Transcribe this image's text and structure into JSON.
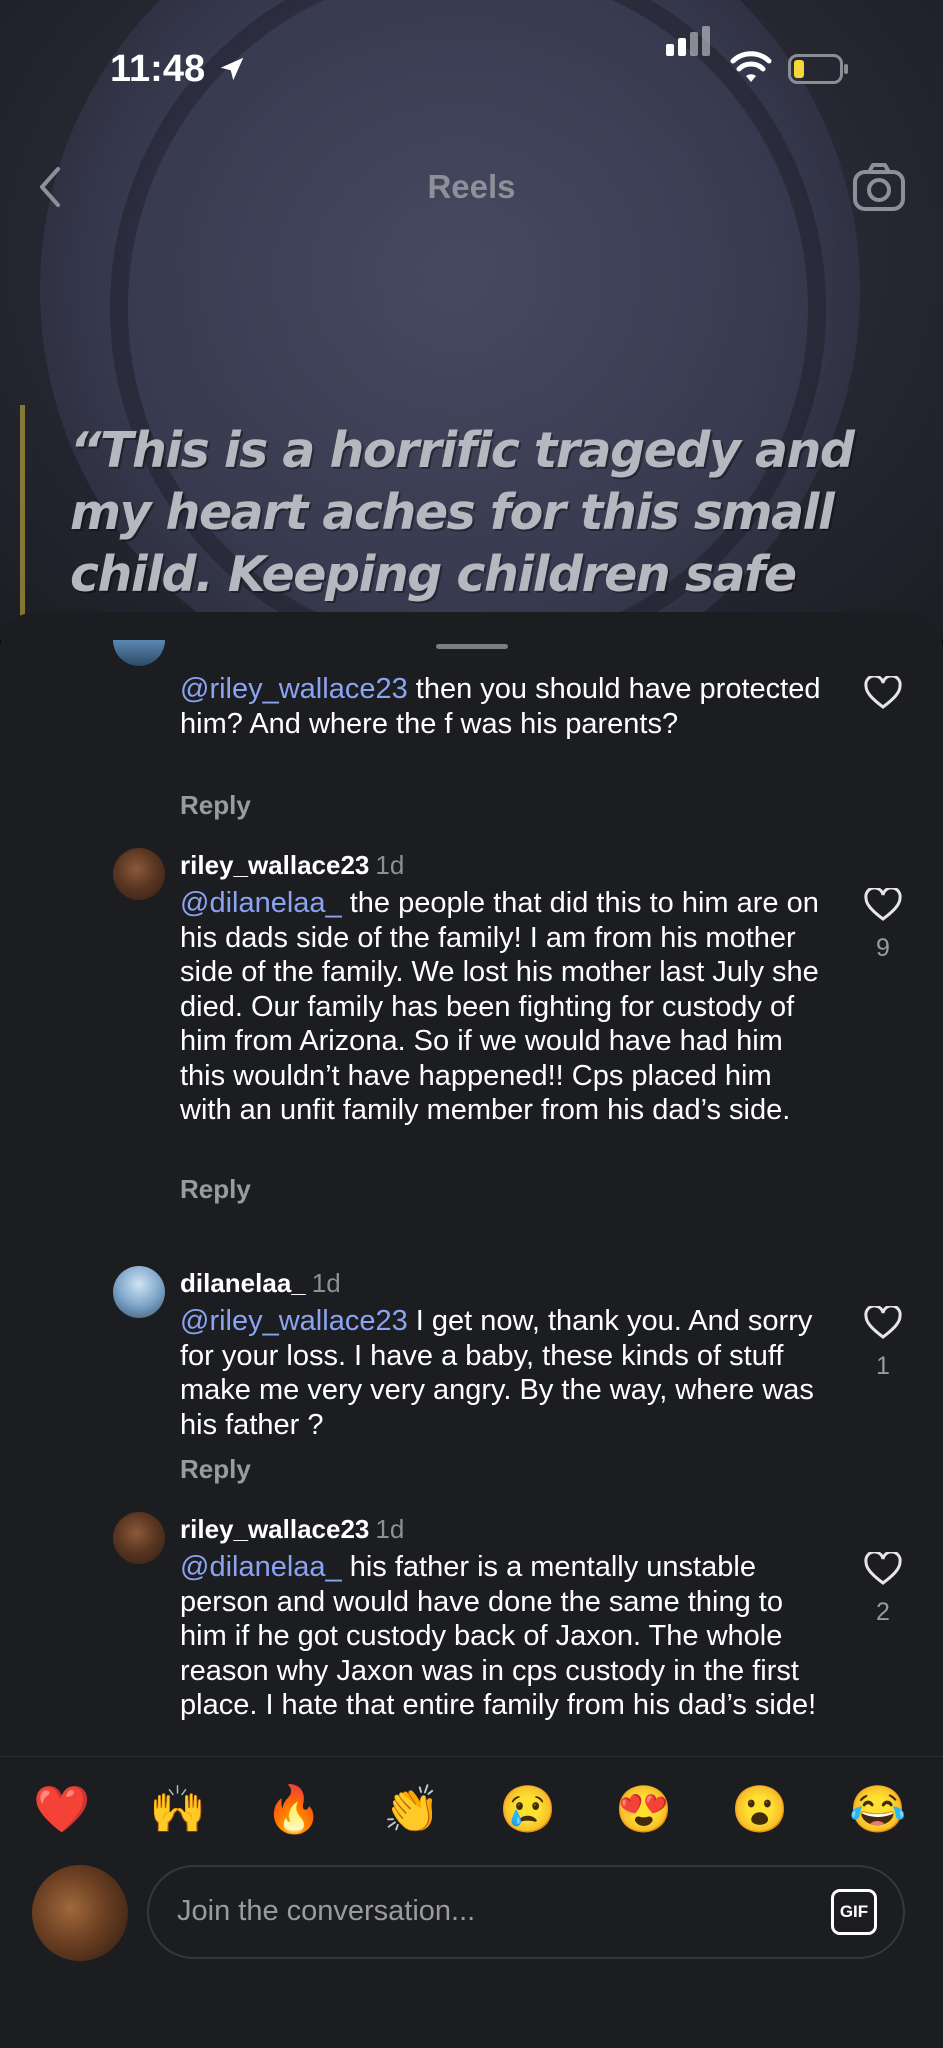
{
  "status_bar": {
    "time": "11:48",
    "battery_color": "#f4d83a"
  },
  "header": {
    "title": "Reels",
    "back_icon": "chevron-left-icon",
    "camera_icon": "camera-icon"
  },
  "reel": {
    "quote": "“This is a horrific tragedy and my heart aches for this small child. Keeping children safe"
  },
  "comments": [
    {
      "mention": "@riley_wallace23",
      "text": " then you should have protected him? And where the f was his parents?",
      "reply": "Reply"
    },
    {
      "user": "riley_wallace23",
      "age": "1d",
      "mention": "@dilanelaa_",
      "text": " the people that did this to him are on his dads side of the family! I am from his mother side of the family. We lost his mother last July she died. Our family has been fighting for custody of him from Arizona. So if we would have had him this wouldn’t have happened!! Cps placed him with an unfit family member from his dad’s side.",
      "likes": "9",
      "reply": "Reply"
    },
    {
      "user": "dilanelaa_",
      "age": "1d",
      "mention": "@riley_wallace23",
      "text": " I get now, thank you. And sorry for your loss. I have a baby, these kinds of stuff make me very very angry. By the way, where was his father ?",
      "likes": "1",
      "reply": "Reply"
    },
    {
      "user": "riley_wallace23",
      "age": "1d",
      "mention": "@dilanelaa_",
      "text": " his father is a mentally unstable person and would have done the same thing to him if he got custody back of Jaxon. The whole reason why Jaxon was in cps custody in the first place. I hate that entire family from his dad’s side!",
      "likes": "2"
    }
  ],
  "emoji_bar": [
    "❤️",
    "🙌",
    "🔥",
    "👏",
    "😢",
    "😍",
    "😮",
    "😂"
  ],
  "input": {
    "placeholder": "Join the conversation...",
    "gif_label": "GIF"
  }
}
